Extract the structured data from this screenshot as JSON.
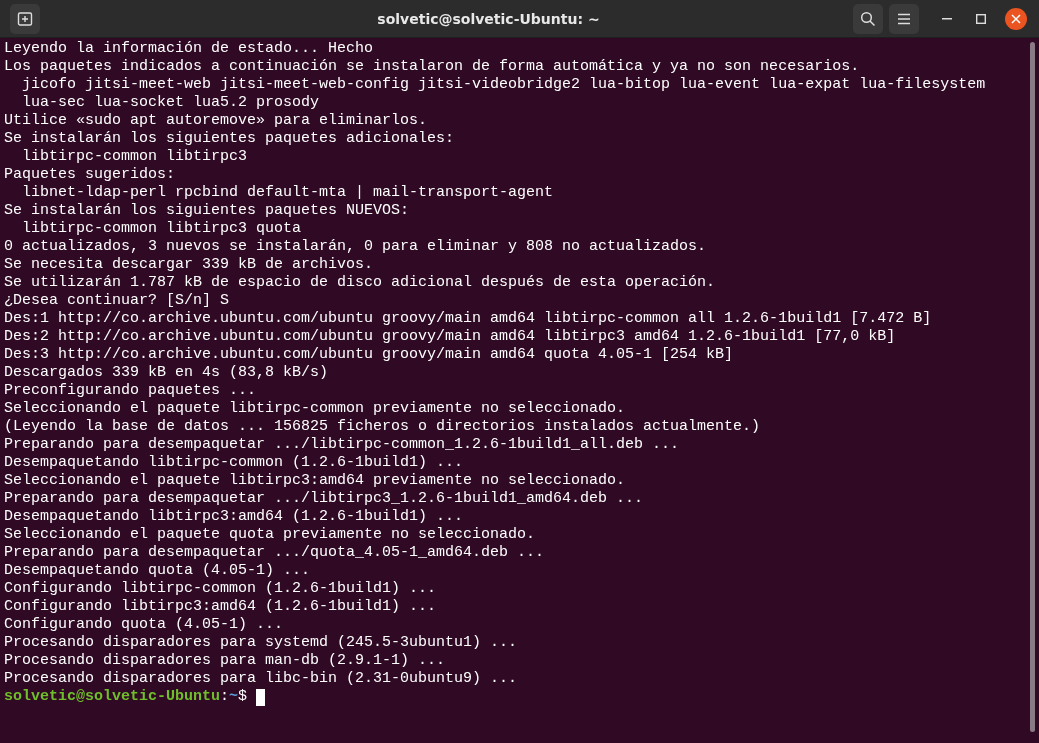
{
  "window": {
    "title": "solvetic@solvetic-Ubuntu: ~"
  },
  "terminal": {
    "lines": [
      "Leyendo la información de estado... Hecho",
      "Los paquetes indicados a continuación se instalaron de forma automática y ya no son necesarios.",
      "  jicofo jitsi-meet-web jitsi-meet-web-config jitsi-videobridge2 lua-bitop lua-event lua-expat lua-filesystem",
      "  lua-sec lua-socket lua5.2 prosody",
      "Utilice «sudo apt autoremove» para eliminarlos.",
      "Se instalarán los siguientes paquetes adicionales:",
      "  libtirpc-common libtirpc3",
      "Paquetes sugeridos:",
      "  libnet-ldap-perl rpcbind default-mta | mail-transport-agent",
      "Se instalarán los siguientes paquetes NUEVOS:",
      "  libtirpc-common libtirpc3 quota",
      "0 actualizados, 3 nuevos se instalarán, 0 para eliminar y 808 no actualizados.",
      "Se necesita descargar 339 kB de archivos.",
      "Se utilizarán 1.787 kB de espacio de disco adicional después de esta operación.",
      "¿Desea continuar? [S/n] S",
      "Des:1 http://co.archive.ubuntu.com/ubuntu groovy/main amd64 libtirpc-common all 1.2.6-1build1 [7.472 B]",
      "Des:2 http://co.archive.ubuntu.com/ubuntu groovy/main amd64 libtirpc3 amd64 1.2.6-1build1 [77,0 kB]",
      "Des:3 http://co.archive.ubuntu.com/ubuntu groovy/main amd64 quota 4.05-1 [254 kB]",
      "Descargados 339 kB en 4s (83,8 kB/s)",
      "Preconfigurando paquetes ...",
      "Seleccionando el paquete libtirpc-common previamente no seleccionado.",
      "(Leyendo la base de datos ... 156825 ficheros o directorios instalados actualmente.)",
      "Preparando para desempaquetar .../libtirpc-common_1.2.6-1build1_all.deb ...",
      "Desempaquetando libtirpc-common (1.2.6-1build1) ...",
      "Seleccionando el paquete libtirpc3:amd64 previamente no seleccionado.",
      "Preparando para desempaquetar .../libtirpc3_1.2.6-1build1_amd64.deb ...",
      "Desempaquetando libtirpc3:amd64 (1.2.6-1build1) ...",
      "Seleccionando el paquete quota previamente no seleccionado.",
      "Preparando para desempaquetar .../quota_4.05-1_amd64.deb ...",
      "Desempaquetando quota (4.05-1) ...",
      "Configurando libtirpc-common (1.2.6-1build1) ...",
      "Configurando libtirpc3:amd64 (1.2.6-1build1) ...",
      "Configurando quota (4.05-1) ...",
      "Procesando disparadores para systemd (245.5-3ubuntu1) ...",
      "Procesando disparadores para man-db (2.9.1-1) ...",
      "Procesando disparadores para libc-bin (2.31-0ubuntu9) ..."
    ],
    "prompt": {
      "user_host": "solvetic@solvetic-Ubuntu",
      "separator": ":",
      "path": "~",
      "symbol": "$"
    }
  }
}
